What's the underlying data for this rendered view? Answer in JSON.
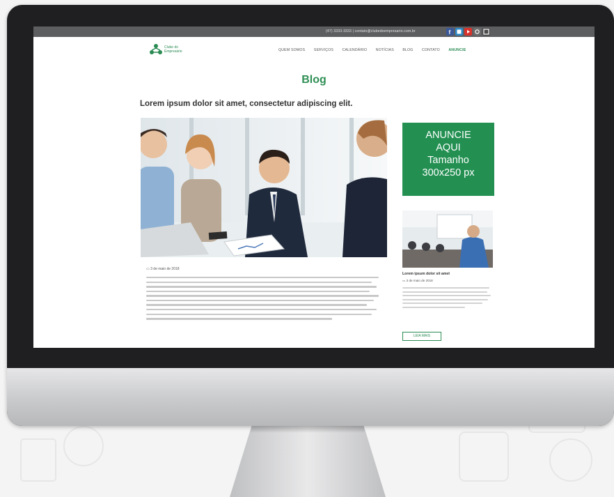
{
  "topbar": {
    "contact_text": "(47) 3333-3333 | contato@clubedoempresario.com.br",
    "social_icons": [
      "facebook-icon",
      "linkedin-icon",
      "youtube-icon",
      "instagram-icon",
      "linkedin-square-icon"
    ]
  },
  "logo": {
    "name_line1": "Clube do",
    "name_line2": "Empresário",
    "brand_color": "#2a8b53"
  },
  "nav": {
    "items": [
      "QUEM SOMOS",
      "SERVIÇOS",
      "CALENDÁRIO",
      "NOTÍCIAS",
      "BLOG",
      "CONTATO",
      "ANUNCIE"
    ]
  },
  "page": {
    "title": "Blog",
    "post_title": "Lorem ipsum dolor sit amet, consectetur adipiscing elit.",
    "post_date": "3 de maio de 2018"
  },
  "ad": {
    "line1": "ANUNCIE",
    "line2": "AQUI",
    "line3": "Tamanho",
    "line4": "300x250 px",
    "color": "#239052"
  },
  "sidebar": {
    "post_title": "Lorem ipsum dolor sit amet",
    "post_date": "3 de maio de 2018",
    "button_label": "LEIA MAIS"
  }
}
